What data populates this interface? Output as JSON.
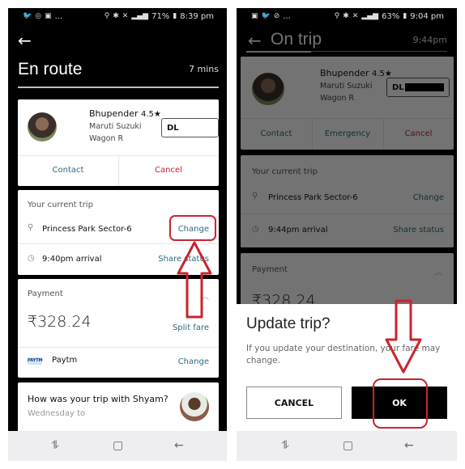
{
  "left": {
    "status_bar": {
      "left_icons": [
        "twitter-icon",
        "chrome-icon",
        "gallery-icon",
        "more-icon"
      ],
      "more": "...",
      "battery": "71%",
      "time": "8:39 pm"
    },
    "title": "En route",
    "eta": "7 mins",
    "driver": {
      "name": "Bhupender",
      "rating": "4.5★",
      "car_make": "Maruti Suzuki",
      "car_model": "Wagon R",
      "plate": "DL"
    },
    "driver_actions": {
      "contact": "Contact",
      "cancel": "Cancel"
    },
    "trip": {
      "section_label": "Your current trip",
      "destination": "Princess Park Sector-6",
      "change_label": "Change",
      "arrival": "9:40pm arrival",
      "share_label": "Share status"
    },
    "payment": {
      "section_label": "Payment",
      "fare": "₹328.24",
      "split_label": "Split fare",
      "method_logo": "PAYTM",
      "method": "Paytm",
      "change_label": "Change"
    },
    "rating_card": {
      "question": "How was your trip with Shyam?",
      "subtext": "Wednesday to"
    }
  },
  "right": {
    "status_bar": {
      "left_icons": [
        "gallery-icon",
        "twitter-icon",
        "sync-icon",
        "more-icon"
      ],
      "more": "...",
      "battery": "63%",
      "time": "9:04 pm"
    },
    "title": "On trip",
    "eta_time": "9:44pm",
    "driver": {
      "name": "Bhupender",
      "rating": "4.5★",
      "car_make": "Maruti Suzuki",
      "car_model": "Wagon R",
      "plate": "DL"
    },
    "driver_actions": {
      "contact": "Contact",
      "emergency": "Emergency",
      "cancel": "Cancel"
    },
    "trip": {
      "section_label": "Your current trip",
      "destination": "Princess Park Sector-6",
      "change_label": "Change",
      "arrival": "9:44pm arrival",
      "share_label": "Share status"
    },
    "payment": {
      "section_label": "Payment",
      "fare": "₹328.24"
    },
    "dialog": {
      "title": "Update trip?",
      "body": "If you update your destination, your fare may change.",
      "cancel_label": "CANCEL",
      "ok_label": "OK"
    }
  },
  "nav_bar": {
    "icons": [
      "recent-apps-icon",
      "home-icon",
      "back-icon"
    ]
  },
  "annotation_color": "#c9242d"
}
